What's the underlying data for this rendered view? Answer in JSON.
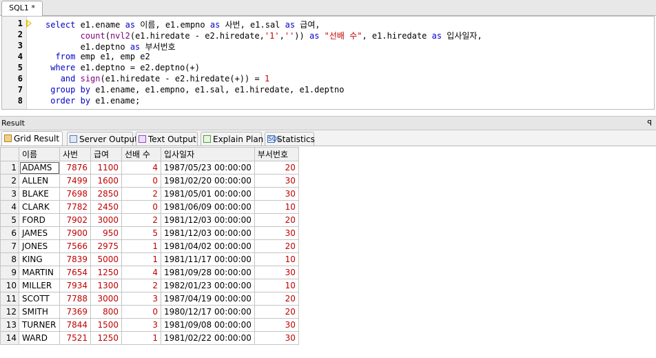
{
  "editor_tab": {
    "label": "SQL1 *"
  },
  "editor": {
    "line_numbers": [
      "1",
      "2",
      "3",
      "4",
      "5",
      "6",
      "7",
      "8"
    ]
  },
  "result_panel": {
    "title": "Result",
    "pin": "ꟼ"
  },
  "result_tabs": [
    {
      "label": "Grid Result",
      "icon": "grid-icon"
    },
    {
      "label": "Server Output",
      "icon": "server-icon"
    },
    {
      "label": "Text Output",
      "icon": "text-output-icon"
    },
    {
      "label": "Explain Plan",
      "icon": "explain-plan-icon"
    },
    {
      "label": "Statistics",
      "icon": "statistics-icon"
    }
  ],
  "grid": {
    "columns": [
      "이름",
      "사번",
      "급여",
      "선배 수",
      "입사일자",
      "부서번호"
    ],
    "rows": [
      [
        "ADAMS",
        "7876",
        "1100",
        "4",
        "1987/05/23 00:00:00",
        "20"
      ],
      [
        "ALLEN",
        "7499",
        "1600",
        "0",
        "1981/02/20 00:00:00",
        "30"
      ],
      [
        "BLAKE",
        "7698",
        "2850",
        "2",
        "1981/05/01 00:00:00",
        "30"
      ],
      [
        "CLARK",
        "7782",
        "2450",
        "0",
        "1981/06/09 00:00:00",
        "10"
      ],
      [
        "FORD",
        "7902",
        "3000",
        "2",
        "1981/12/03 00:00:00",
        "20"
      ],
      [
        "JAMES",
        "7900",
        "950",
        "5",
        "1981/12/03 00:00:00",
        "30"
      ],
      [
        "JONES",
        "7566",
        "2975",
        "1",
        "1981/04/02 00:00:00",
        "20"
      ],
      [
        "KING",
        "7839",
        "5000",
        "1",
        "1981/11/17 00:00:00",
        "10"
      ],
      [
        "MARTIN",
        "7654",
        "1250",
        "4",
        "1981/09/28 00:00:00",
        "30"
      ],
      [
        "MILLER",
        "7934",
        "1300",
        "2",
        "1982/01/23 00:00:00",
        "10"
      ],
      [
        "SCOTT",
        "7788",
        "3000",
        "3",
        "1987/04/19 00:00:00",
        "20"
      ],
      [
        "SMITH",
        "7369",
        "800",
        "0",
        "1980/12/17 00:00:00",
        "20"
      ],
      [
        "TURNER",
        "7844",
        "1500",
        "3",
        "1981/09/08 00:00:00",
        "30"
      ],
      [
        "WARD",
        "7521",
        "1250",
        "1",
        "1981/02/22 00:00:00",
        "30"
      ]
    ]
  }
}
